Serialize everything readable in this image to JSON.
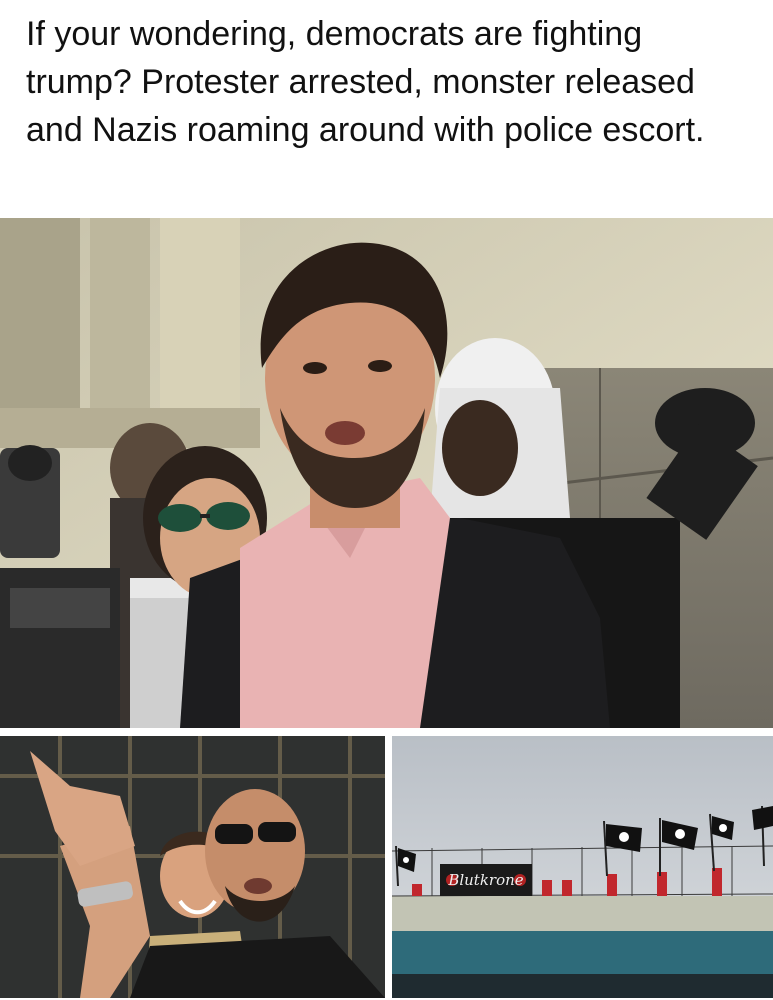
{
  "post": {
    "caption": "If your wondering, democrats are fighting trump? Protester arrested, monster released and Nazis roaming around with police escort."
  },
  "photos": {
    "main": {
      "icon": "protest-press-photo"
    },
    "bottom_left": {
      "icon": "two-men-pointing-photo"
    },
    "bottom_right": {
      "icon": "overpass-flags-photo",
      "banner_text": "Blutkrone"
    }
  },
  "colors": {
    "text": "#111111",
    "background": "#ffffff",
    "shirt": "#e9b3b3",
    "banner": "#1a1a1a",
    "sky": "#c9cdd2",
    "bridge": "#2e6b7a"
  }
}
